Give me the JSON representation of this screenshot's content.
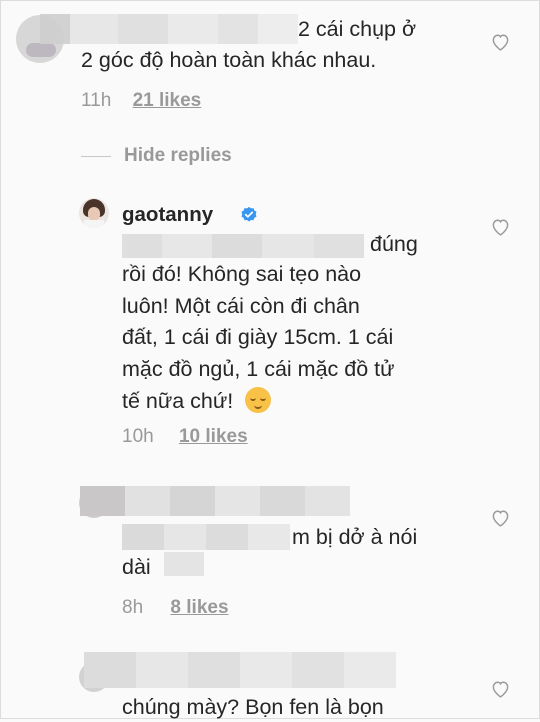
{
  "comments": [
    {
      "text_line1": "2 cái chụp ở",
      "text_line2": "2 góc độ hoàn toàn khác nhau.",
      "time": "11h",
      "likes": "21 likes"
    },
    {
      "username": "gaotanny",
      "text_line1_end": "đúng",
      "text_lines": [
        "rồi đó! Không sai tẹo nào",
        "luôn! Một cái còn đi chân",
        "đất, 1 cái đi giày 15cm. 1 cái",
        "mặc đồ ngủ, 1 cái mặc đồ tử",
        "tế nữa chứ!"
      ],
      "emoji": "😌",
      "time": "10h",
      "likes": "10 likes"
    },
    {
      "text_line1": "m bị dở à nói",
      "text_line2": "dài",
      "time": "8h",
      "likes": "8 likes"
    },
    {
      "text_line1": "chúng mày? Bọn fen là bọn"
    }
  ],
  "hide_replies": "Hide replies",
  "colors": {
    "verified": "#3897f0",
    "muted": "#999999",
    "text": "#262626"
  }
}
